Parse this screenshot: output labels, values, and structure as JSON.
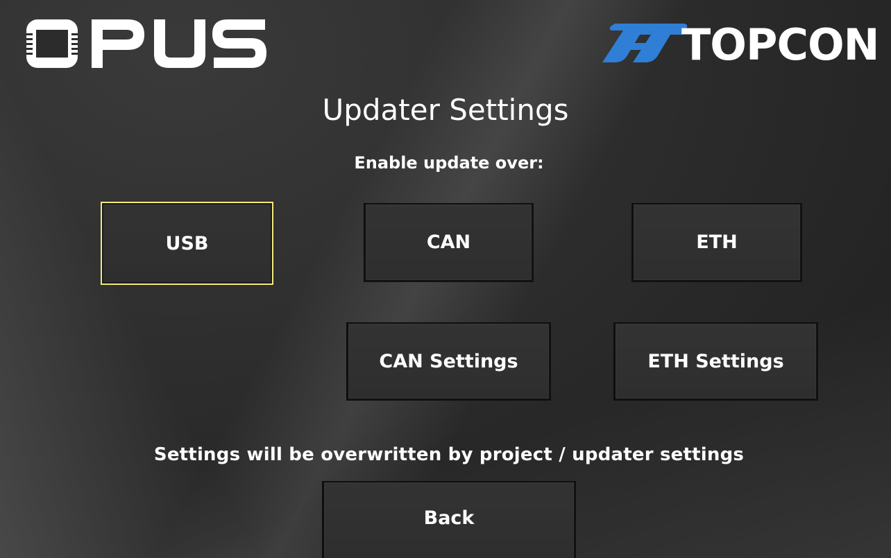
{
  "logos": {
    "left_brand": "OPUS",
    "right_brand": "TOPCON",
    "right_brand_color": "#2f7fd6"
  },
  "page": {
    "title": "Updater Settings",
    "subtitle": "Enable update over:",
    "note": "Settings will be overwritten by project / updater settings"
  },
  "buttons": {
    "usb": {
      "label": "USB",
      "selected": true
    },
    "can": {
      "label": "CAN",
      "selected": false
    },
    "eth": {
      "label": "ETH",
      "selected": false
    },
    "can_settings": {
      "label": "CAN Settings"
    },
    "eth_settings": {
      "label": "ETH Settings"
    },
    "back": {
      "label": "Back"
    }
  },
  "colors": {
    "selection_border": "#f2ea7a",
    "text": "#ffffff"
  }
}
